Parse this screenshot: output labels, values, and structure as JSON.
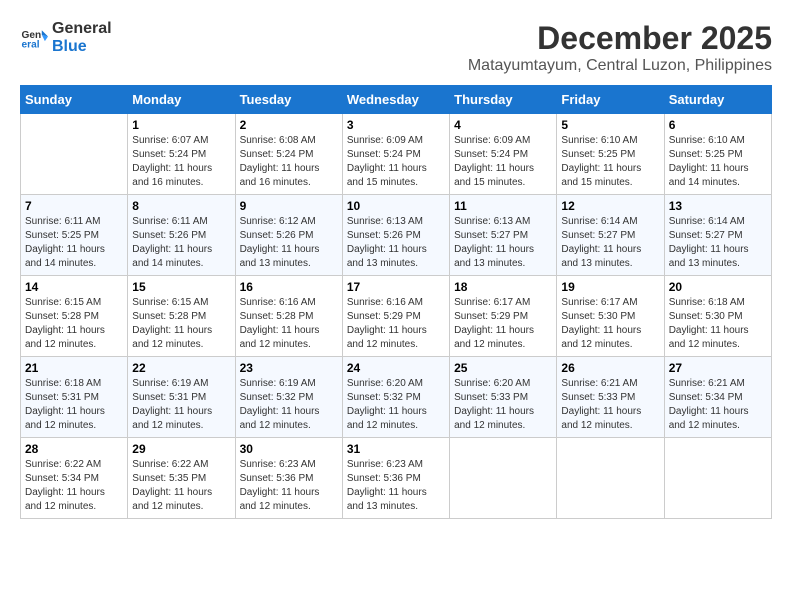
{
  "logo": {
    "line1": "General",
    "line2": "Blue"
  },
  "title": "December 2025",
  "location": "Matayumtayum, Central Luzon, Philippines",
  "weekdays": [
    "Sunday",
    "Monday",
    "Tuesday",
    "Wednesday",
    "Thursday",
    "Friday",
    "Saturday"
  ],
  "weeks": [
    [
      {
        "day": "",
        "empty": true
      },
      {
        "day": "1",
        "sunrise": "6:07 AM",
        "sunset": "5:24 PM",
        "daylight": "11 hours and 16 minutes."
      },
      {
        "day": "2",
        "sunrise": "6:08 AM",
        "sunset": "5:24 PM",
        "daylight": "11 hours and 16 minutes."
      },
      {
        "day": "3",
        "sunrise": "6:09 AM",
        "sunset": "5:24 PM",
        "daylight": "11 hours and 15 minutes."
      },
      {
        "day": "4",
        "sunrise": "6:09 AM",
        "sunset": "5:24 PM",
        "daylight": "11 hours and 15 minutes."
      },
      {
        "day": "5",
        "sunrise": "6:10 AM",
        "sunset": "5:25 PM",
        "daylight": "11 hours and 15 minutes."
      },
      {
        "day": "6",
        "sunrise": "6:10 AM",
        "sunset": "5:25 PM",
        "daylight": "11 hours and 14 minutes."
      }
    ],
    [
      {
        "day": "7",
        "sunrise": "6:11 AM",
        "sunset": "5:25 PM",
        "daylight": "11 hours and 14 minutes."
      },
      {
        "day": "8",
        "sunrise": "6:11 AM",
        "sunset": "5:26 PM",
        "daylight": "11 hours and 14 minutes."
      },
      {
        "day": "9",
        "sunrise": "6:12 AM",
        "sunset": "5:26 PM",
        "daylight": "11 hours and 13 minutes."
      },
      {
        "day": "10",
        "sunrise": "6:13 AM",
        "sunset": "5:26 PM",
        "daylight": "11 hours and 13 minutes."
      },
      {
        "day": "11",
        "sunrise": "6:13 AM",
        "sunset": "5:27 PM",
        "daylight": "11 hours and 13 minutes."
      },
      {
        "day": "12",
        "sunrise": "6:14 AM",
        "sunset": "5:27 PM",
        "daylight": "11 hours and 13 minutes."
      },
      {
        "day": "13",
        "sunrise": "6:14 AM",
        "sunset": "5:27 PM",
        "daylight": "11 hours and 13 minutes."
      }
    ],
    [
      {
        "day": "14",
        "sunrise": "6:15 AM",
        "sunset": "5:28 PM",
        "daylight": "11 hours and 12 minutes."
      },
      {
        "day": "15",
        "sunrise": "6:15 AM",
        "sunset": "5:28 PM",
        "daylight": "11 hours and 12 minutes."
      },
      {
        "day": "16",
        "sunrise": "6:16 AM",
        "sunset": "5:28 PM",
        "daylight": "11 hours and 12 minutes."
      },
      {
        "day": "17",
        "sunrise": "6:16 AM",
        "sunset": "5:29 PM",
        "daylight": "11 hours and 12 minutes."
      },
      {
        "day": "18",
        "sunrise": "6:17 AM",
        "sunset": "5:29 PM",
        "daylight": "11 hours and 12 minutes."
      },
      {
        "day": "19",
        "sunrise": "6:17 AM",
        "sunset": "5:30 PM",
        "daylight": "11 hours and 12 minutes."
      },
      {
        "day": "20",
        "sunrise": "6:18 AM",
        "sunset": "5:30 PM",
        "daylight": "11 hours and 12 minutes."
      }
    ],
    [
      {
        "day": "21",
        "sunrise": "6:18 AM",
        "sunset": "5:31 PM",
        "daylight": "11 hours and 12 minutes."
      },
      {
        "day": "22",
        "sunrise": "6:19 AM",
        "sunset": "5:31 PM",
        "daylight": "11 hours and 12 minutes."
      },
      {
        "day": "23",
        "sunrise": "6:19 AM",
        "sunset": "5:32 PM",
        "daylight": "11 hours and 12 minutes."
      },
      {
        "day": "24",
        "sunrise": "6:20 AM",
        "sunset": "5:32 PM",
        "daylight": "11 hours and 12 minutes."
      },
      {
        "day": "25",
        "sunrise": "6:20 AM",
        "sunset": "5:33 PM",
        "daylight": "11 hours and 12 minutes."
      },
      {
        "day": "26",
        "sunrise": "6:21 AM",
        "sunset": "5:33 PM",
        "daylight": "11 hours and 12 minutes."
      },
      {
        "day": "27",
        "sunrise": "6:21 AM",
        "sunset": "5:34 PM",
        "daylight": "11 hours and 12 minutes."
      }
    ],
    [
      {
        "day": "28",
        "sunrise": "6:22 AM",
        "sunset": "5:34 PM",
        "daylight": "11 hours and 12 minutes."
      },
      {
        "day": "29",
        "sunrise": "6:22 AM",
        "sunset": "5:35 PM",
        "daylight": "11 hours and 12 minutes."
      },
      {
        "day": "30",
        "sunrise": "6:23 AM",
        "sunset": "5:36 PM",
        "daylight": "11 hours and 12 minutes."
      },
      {
        "day": "31",
        "sunrise": "6:23 AM",
        "sunset": "5:36 PM",
        "daylight": "11 hours and 13 minutes."
      },
      {
        "day": "",
        "empty": true
      },
      {
        "day": "",
        "empty": true
      },
      {
        "day": "",
        "empty": true
      }
    ]
  ],
  "labels": {
    "sunrise": "Sunrise: ",
    "sunset": "Sunset: ",
    "daylight": "Daylight: "
  }
}
